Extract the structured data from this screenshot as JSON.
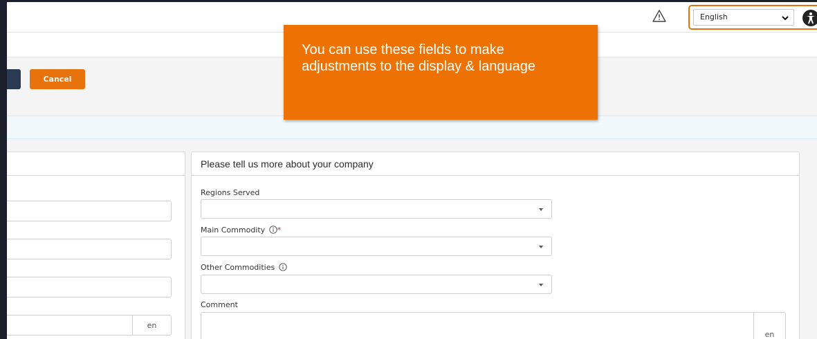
{
  "header": {
    "warning_icon": "warning-triangle-icon",
    "language": {
      "selected": "English",
      "chevron_icon": "chevron-down-icon"
    },
    "accessibility_icon": "accessibility-icon"
  },
  "toolbar": {
    "cancel_label": "Cancel"
  },
  "left_panel": {
    "lang_tag": "en"
  },
  "right_panel": {
    "title": "Please tell us more about your company",
    "fields": {
      "regions_served": "Regions Served",
      "main_commodity": "Main Commodity",
      "main_commodity_required": "*",
      "other_commodities": "Other Commodities",
      "comment": "Comment",
      "comment_lang_tag": "en"
    }
  },
  "callout": {
    "text": "You can use these fields to make adjustments to the display & language"
  },
  "colors": {
    "accent": "#ee7203",
    "button_orange": "#e8720c",
    "save_button": "#2a3a52",
    "required": "#d32f2f"
  }
}
